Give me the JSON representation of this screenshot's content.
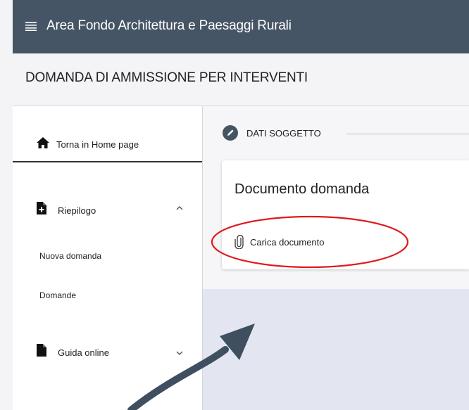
{
  "app": {
    "title": "Area Fondo Architettura e Paesaggi Rurali",
    "menu_icon": "hamburger-icon"
  },
  "page": {
    "heading": "DOMANDA DI AMMISSIONE PER INTERVENTI"
  },
  "sidebar": {
    "home": {
      "label": "Torna in Home page",
      "icon": "home-icon"
    },
    "sections": [
      {
        "label": "Riepilogo",
        "icon": "file-add-icon",
        "expanded": true,
        "items": [
          "Nuova domanda",
          "Domande"
        ]
      },
      {
        "label": "Guida online",
        "icon": "file-icon",
        "expanded": false
      }
    ]
  },
  "stepper": {
    "label": "DATI SOGGETTO",
    "icon": "pencil-icon"
  },
  "card": {
    "title": "Documento domanda",
    "upload_label": "Carica documento",
    "upload_icon": "paperclip-icon"
  },
  "annotation": {
    "highlight_color": "#e0191e",
    "arrow_color": "#3f4f60"
  },
  "colors": {
    "topbar": "#455565",
    "content_bg": "#e3e5f1"
  }
}
